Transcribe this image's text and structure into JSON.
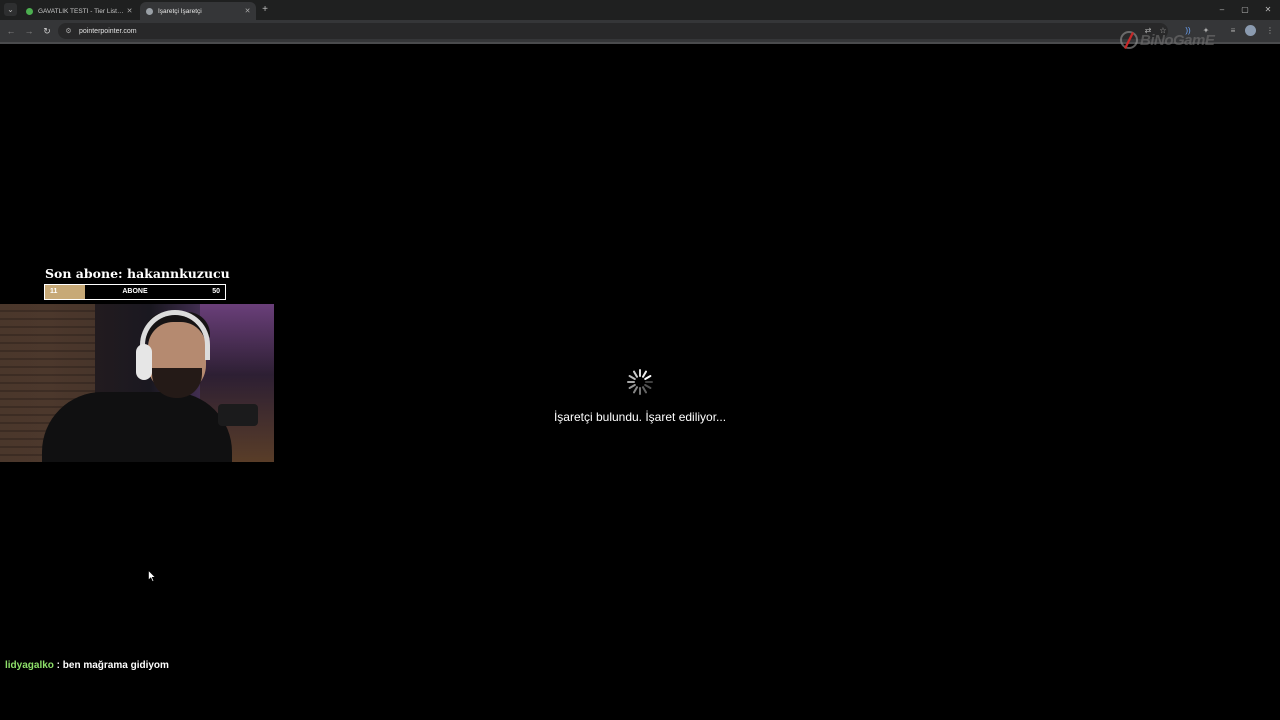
{
  "browser": {
    "tabs": [
      {
        "title": "GAVATLIK TESTİ - Tier List, Kör",
        "active": false,
        "favicon_color": "#4caf50"
      },
      {
        "title": "İşaretçi İşaretçi",
        "active": true,
        "favicon_color": "#9aa0a6"
      }
    ],
    "new_tab_symbol": "+",
    "close_symbol": "✕",
    "window_controls": {
      "minimize": "–",
      "maximize": "▢",
      "close": "✕"
    },
    "url": "pointerpointer.com"
  },
  "watermark": {
    "text": "BiNoGamE"
  },
  "overlay": {
    "sub_label": "Son abone: hakannkuzucu",
    "sub_goal": {
      "current": "11",
      "label": "ABONE",
      "target": "50",
      "progress_fraction": 0.22,
      "fill_color": "#c7a977"
    }
  },
  "loading": {
    "message": "İşaretçi bulundu. İşaret ediliyor..."
  },
  "chat": {
    "user": "lidyagalko",
    "separator": " : ",
    "message": "ben mağrama gidiyom",
    "user_color": "#8ee06a"
  }
}
